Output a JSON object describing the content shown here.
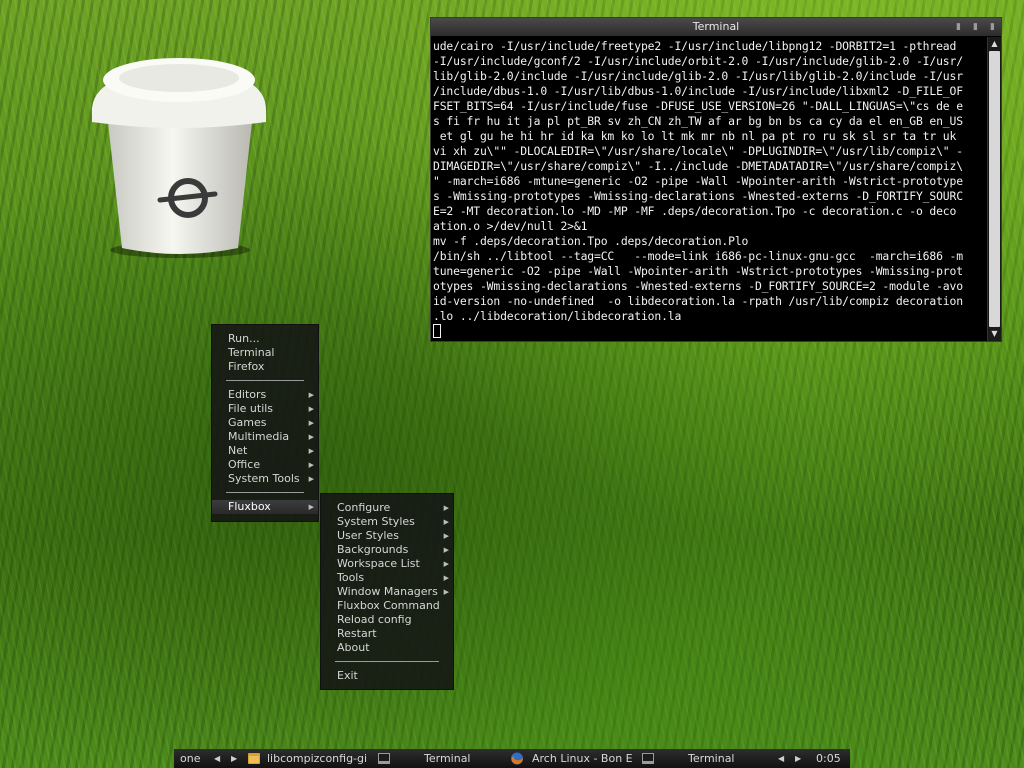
{
  "terminal": {
    "title": "Terminal",
    "lines": [
      "ude/cairo -I/usr/include/freetype2 -I/usr/include/libpng12 -DORBIT2=1 -pthread",
      "-I/usr/include/gconf/2 -I/usr/include/orbit-2.0 -I/usr/include/glib-2.0 -I/usr/",
      "lib/glib-2.0/include -I/usr/include/glib-2.0 -I/usr/lib/glib-2.0/include -I/usr",
      "/include/dbus-1.0 -I/usr/lib/dbus-1.0/include -I/usr/include/libxml2 -D_FILE_OF",
      "FSET_BITS=64 -I/usr/include/fuse -DFUSE_USE_VERSION=26 \"-DALL_LINGUAS=\\\"cs de e",
      "s fi fr hu it ja pl pt_BR sv zh_CN zh_TW af ar bg bn bs ca cy da el en_GB en_US",
      " et gl gu he hi hr id ka km ko lo lt mk mr nb nl pa pt ro ru sk sl sr ta tr uk",
      "vi xh zu\\\"\" -DLOCALEDIR=\\\"/usr/share/locale\\\" -DPLUGINDIR=\\\"/usr/lib/compiz\\\" -",
      "DIMAGEDIR=\\\"/usr/share/compiz\\\" -I../include -DMETADATADIR=\\\"/usr/share/compiz\\",
      "\" -march=i686 -mtune=generic -O2 -pipe -Wall -Wpointer-arith -Wstrict-prototype",
      "s -Wmissing-prototypes -Wmissing-declarations -Wnested-externs -D_FORTIFY_SOURC",
      "E=2 -MT decoration.lo -MD -MP -MF .deps/decoration.Tpo -c decoration.c -o deco",
      "ation.o >/dev/null 2>&1",
      "mv -f .deps/decoration.Tpo .deps/decoration.Plo",
      "/bin/sh ../libtool --tag=CC   --mode=link i686-pc-linux-gnu-gcc  -march=i686 -m",
      "tune=generic -O2 -pipe -Wall -Wpointer-arith -Wstrict-prototypes -Wmissing-prot",
      "otypes -Wmissing-declarations -Wnested-externs -D_FORTIFY_SOURCE=2 -module -avo",
      "id-version -no-undefined  -o libdecoration.la -rpath /usr/lib/compiz decoration",
      ".lo ../libdecoration/libdecoration.la"
    ]
  },
  "root_menu": {
    "items": [
      "Run...",
      "Terminal",
      "Firefox"
    ],
    "submenus": [
      "Editors",
      "File utils",
      "Games",
      "Multimedia",
      "Net",
      "Office",
      "System Tools"
    ],
    "active": "Fluxbox"
  },
  "fluxbox_menu": {
    "submenu_items": [
      "Configure",
      "System Styles",
      "User Styles",
      "Backgrounds",
      "Workspace List",
      "Tools",
      "Window Managers"
    ],
    "items": [
      "Fluxbox Command",
      "Reload config",
      "Restart",
      "About"
    ],
    "exit": "Exit"
  },
  "taskbar": {
    "workspace": "one",
    "tasks": [
      {
        "label": "libcompizconfig-gi",
        "icon": "folder-icon"
      },
      {
        "label": "Terminal",
        "icon": "terminal-icon"
      },
      {
        "label": "Arch Linux - Bon E",
        "icon": "firefox-icon"
      },
      {
        "label": "Terminal",
        "icon": "terminal-icon"
      }
    ],
    "clock": "0:05"
  }
}
